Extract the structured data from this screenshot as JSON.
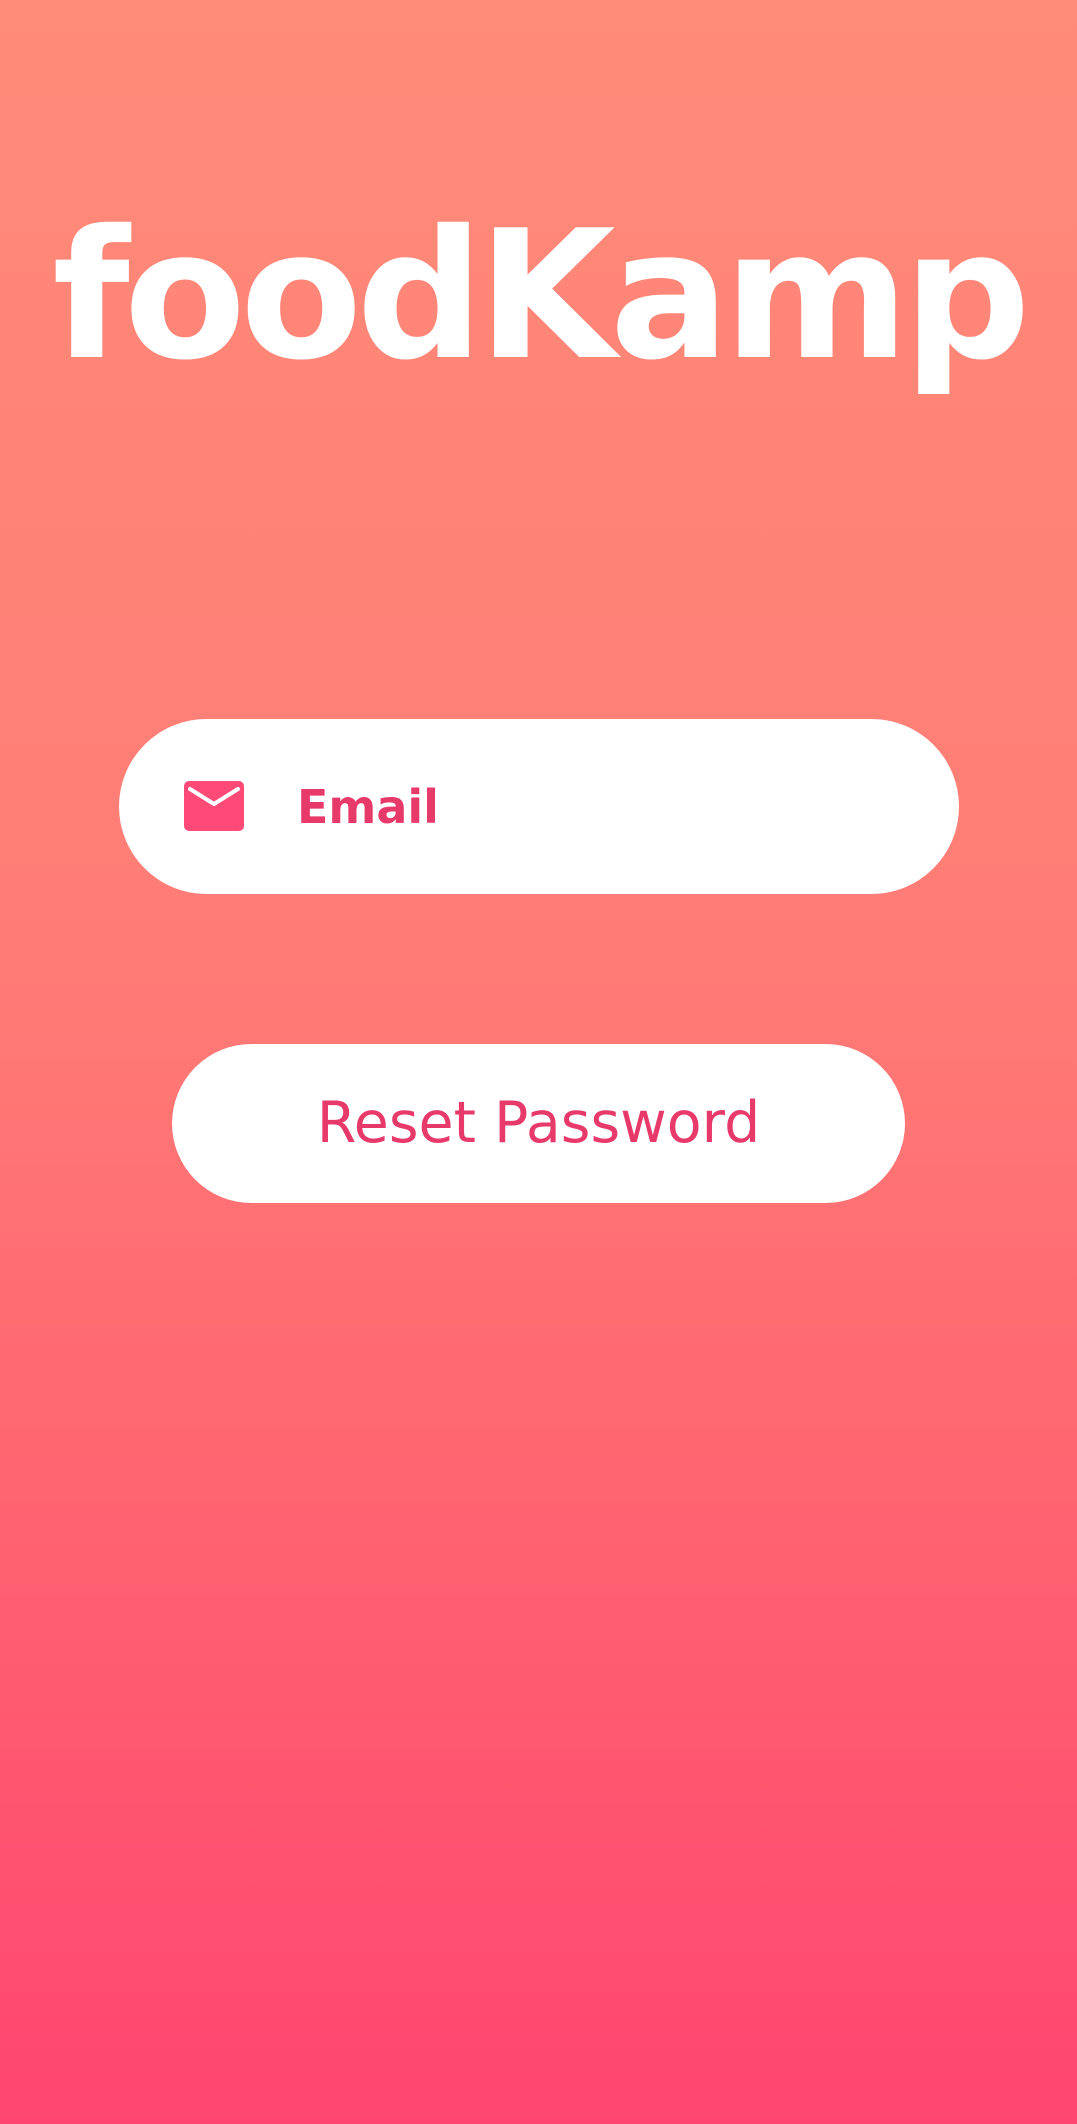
{
  "app": {
    "title": "foodKamp"
  },
  "form": {
    "email": {
      "placeholder": "Email",
      "value": "",
      "icon": "envelope-icon"
    },
    "reset_button_label": "Reset Password"
  },
  "colors": {
    "gradient_top": "#FF8B78",
    "gradient_bottom": "#FF4570",
    "accent": "#E83A6A",
    "icon": "#FF4A78",
    "field_background": "#FFFFFF",
    "title": "#FFFFFF"
  }
}
